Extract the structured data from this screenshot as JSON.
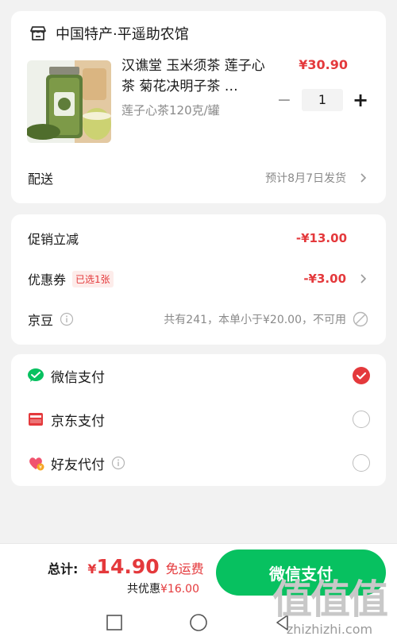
{
  "store": {
    "name": "中国特产·平遥助农馆",
    "icon": "store-icon",
    "product": {
      "title": "汉谯堂 玉米须茶 莲子心茶 菊花决明子茶 …",
      "spec": "莲子心茶120克/罐",
      "price": "¥30.90",
      "quantity": "1",
      "minus_label": "−",
      "plus_label": "+"
    },
    "delivery": {
      "label": "配送",
      "value": "预计8月7日发货"
    }
  },
  "discounts": {
    "promo": {
      "label": "促销立减",
      "value": "-¥13.00"
    },
    "coupon": {
      "label": "优惠券",
      "tag": "已选1张",
      "value": "-¥3.00"
    },
    "jingdou": {
      "label": "京豆",
      "value": "共有241，本单小于¥20.00，不可用"
    }
  },
  "payment": {
    "options": [
      {
        "label": "微信支付",
        "icon": "wechat-pay-icon",
        "selected": true
      },
      {
        "label": "京东支付",
        "icon": "jd-pay-icon",
        "selected": false
      },
      {
        "label": "好友代付",
        "icon": "friend-pay-icon",
        "selected": false
      }
    ]
  },
  "footer": {
    "total_label": "总计:",
    "currency": "¥",
    "total_amount": "14.90",
    "free_shipping": "免运费",
    "saved_prefix": "共优惠",
    "saved_amount": "¥16.00",
    "pay_button": "微信支付"
  },
  "watermark": {
    "big": "值值值",
    "small": "zhizhizhi.com"
  },
  "colors": {
    "accent_red": "#e4393c",
    "wechat_green": "#07c160"
  }
}
